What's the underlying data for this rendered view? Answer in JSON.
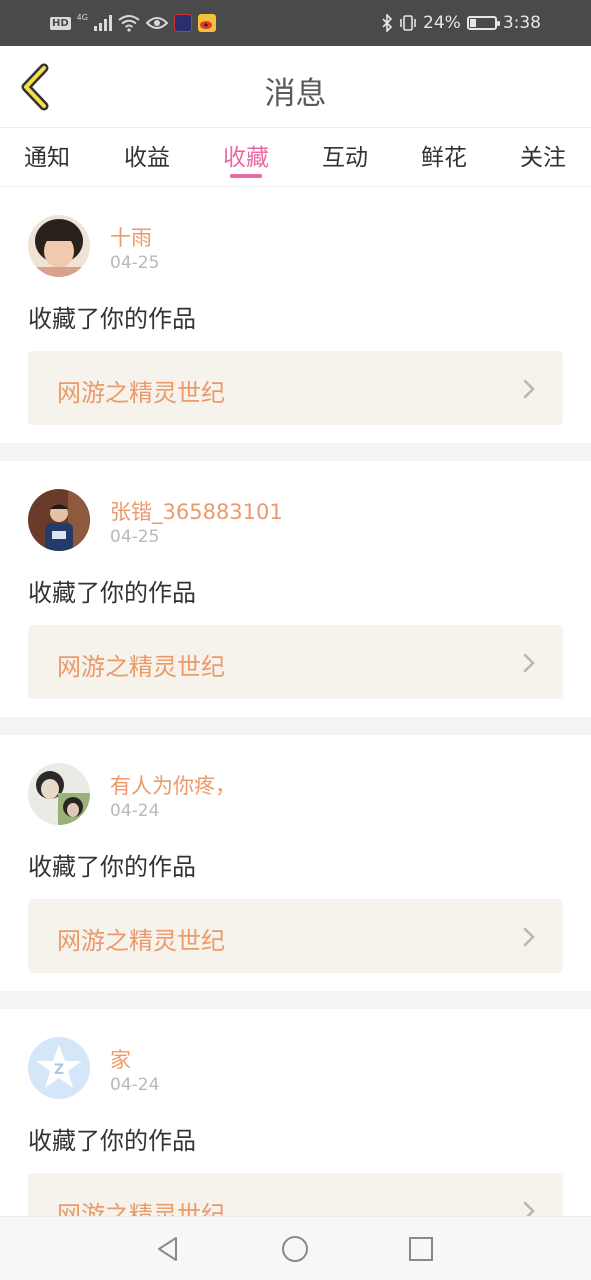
{
  "status_bar": {
    "network_badge": "HD",
    "network_type": "4G",
    "battery_percent": "24%",
    "battery_level": 0.24,
    "time": "3:38",
    "icons": [
      "hd-icon",
      "signal-icon",
      "wifi-icon",
      "eye-icon",
      "app-notification-icon",
      "weibo-icon",
      "bluetooth-icon",
      "vibrate-icon",
      "battery-icon"
    ]
  },
  "header": {
    "title": "消息",
    "back_icon": "back-chevron-icon"
  },
  "tabs": {
    "items": [
      "通知",
      "收益",
      "收藏",
      "互动",
      "鲜花",
      "关注"
    ],
    "active": "收藏",
    "active_color": "#e96aa6"
  },
  "messages": [
    {
      "username": "十雨",
      "date": "04-25",
      "action": "收藏了你的作品",
      "work": "网游之精灵世纪"
    },
    {
      "username": "张锴_365883101",
      "date": "04-25",
      "action": "收藏了你的作品",
      "work": "网游之精灵世纪"
    },
    {
      "username": "有人为你疼，",
      "date": "04-24",
      "action": "收藏了你的作品",
      "work": "网游之精灵世纪"
    },
    {
      "username": "家",
      "date": "04-24",
      "action": "收藏了你的作品",
      "work": "网游之精灵世纪"
    }
  ],
  "colors": {
    "accent_name": "#ec9a6a",
    "card_bg": "#f5f3ec",
    "status_bar": "#4a4a4a"
  },
  "nav_bar": {
    "icons": [
      "back-triangle-icon",
      "home-circle-icon",
      "recents-square-icon"
    ]
  }
}
